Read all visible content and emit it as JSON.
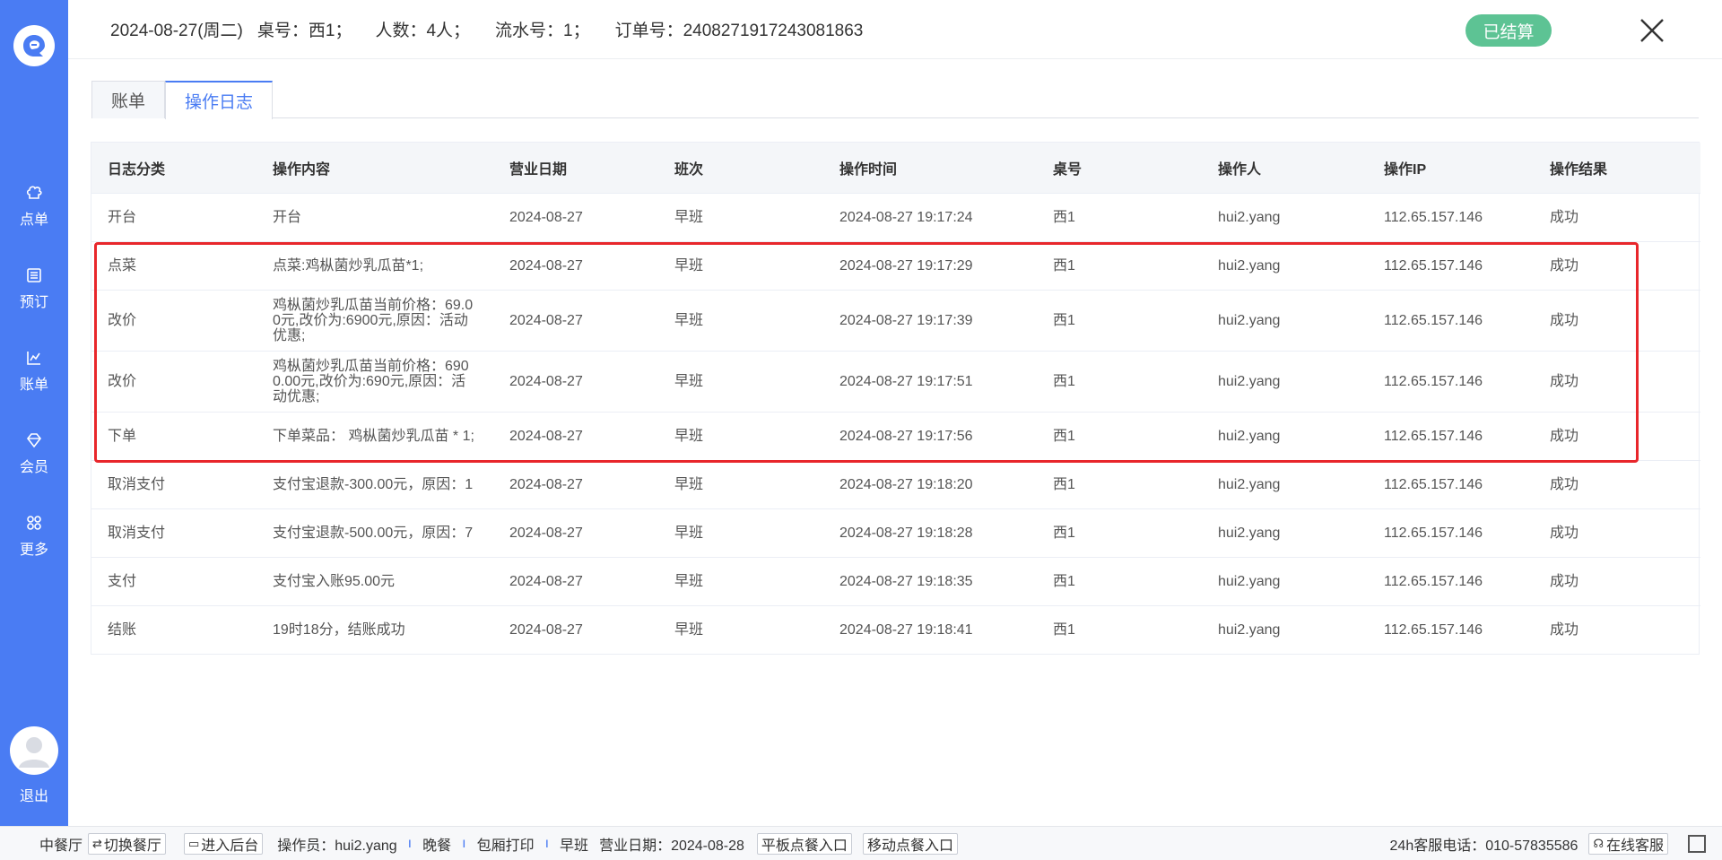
{
  "colors": {
    "brand": "#4a7cf3",
    "status_ok": "#5dc394",
    "highlight": "#e8262b"
  },
  "sidebar": {
    "logo_icon": "brand-logo-icon",
    "items": [
      {
        "label": "点单",
        "icon": "chef-hat-icon"
      },
      {
        "label": "预订",
        "icon": "book-icon"
      },
      {
        "label": "账单",
        "icon": "chart-icon"
      },
      {
        "label": "会员",
        "icon": "diamond-icon"
      },
      {
        "label": "更多",
        "icon": "grid-icon"
      }
    ],
    "logout": "退出"
  },
  "header": {
    "date": "2024-08-27(周二)",
    "table": "桌号：西1；",
    "people": "人数：4人；",
    "serial": "流水号：1；",
    "order": "订单号：2408271917243081863",
    "status": "已结算"
  },
  "tabs": [
    {
      "label": "账单",
      "active": false
    },
    {
      "label": "操作日志",
      "active": true
    }
  ],
  "table": {
    "columns": [
      "日志分类",
      "操作内容",
      "营业日期",
      "班次",
      "操作时间",
      "桌号",
      "操作人",
      "操作IP",
      "操作结果"
    ],
    "rows": [
      [
        "开台",
        "开台",
        "2024-08-27",
        "早班",
        "2024-08-27 19:17:24",
        "西1",
        "hui2.yang",
        "112.65.157.146",
        "成功"
      ],
      [
        "点菜",
        "点菜:鸡枞菌炒乳瓜苗*1;",
        "2024-08-27",
        "早班",
        "2024-08-27 19:17:29",
        "西1",
        "hui2.yang",
        "112.65.157.146",
        "成功"
      ],
      [
        "改价",
        "鸡枞菌炒乳瓜苗当前价格：69.00元,改价为:6900元,原因：活动优惠;",
        "2024-08-27",
        "早班",
        "2024-08-27 19:17:39",
        "西1",
        "hui2.yang",
        "112.65.157.146",
        "成功"
      ],
      [
        "改价",
        "鸡枞菌炒乳瓜苗当前价格：6900.00元,改价为:690元,原因：活动优惠;",
        "2024-08-27",
        "早班",
        "2024-08-27 19:17:51",
        "西1",
        "hui2.yang",
        "112.65.157.146",
        "成功"
      ],
      [
        "下单",
        "下单菜品： 鸡枞菌炒乳瓜苗 * 1;",
        "2024-08-27",
        "早班",
        "2024-08-27 19:17:56",
        "西1",
        "hui2.yang",
        "112.65.157.146",
        "成功"
      ],
      [
        "取消支付",
        "支付宝退款-300.00元，原因：1",
        "2024-08-27",
        "早班",
        "2024-08-27 19:18:20",
        "西1",
        "hui2.yang",
        "112.65.157.146",
        "成功"
      ],
      [
        "取消支付",
        "支付宝退款-500.00元，原因：7",
        "2024-08-27",
        "早班",
        "2024-08-27 19:18:28",
        "西1",
        "hui2.yang",
        "112.65.157.146",
        "成功"
      ],
      [
        "支付",
        "支付宝入账95.00元",
        "2024-08-27",
        "早班",
        "2024-08-27 19:18:35",
        "西1",
        "hui2.yang",
        "112.65.157.146",
        "成功"
      ],
      [
        "结账",
        "19时18分，结账成功",
        "2024-08-27",
        "早班",
        "2024-08-27 19:18:41",
        "西1",
        "hui2.yang",
        "112.65.157.146",
        "成功"
      ]
    ]
  },
  "footer": {
    "hall": "中餐厅",
    "switch_btn": "切换餐厅",
    "backend_btn": "进入后台",
    "operator": "操作员：hui2.yang",
    "meal": "晚餐",
    "print": "包厢打印",
    "shift": "早班",
    "business_date": "营业日期：2024-08-28",
    "tablet_btn": "平板点餐入口",
    "mobile_btn": "移动点餐入口",
    "hotline": "24h客服电话：010-57835586",
    "online_btn": "在线客服"
  }
}
